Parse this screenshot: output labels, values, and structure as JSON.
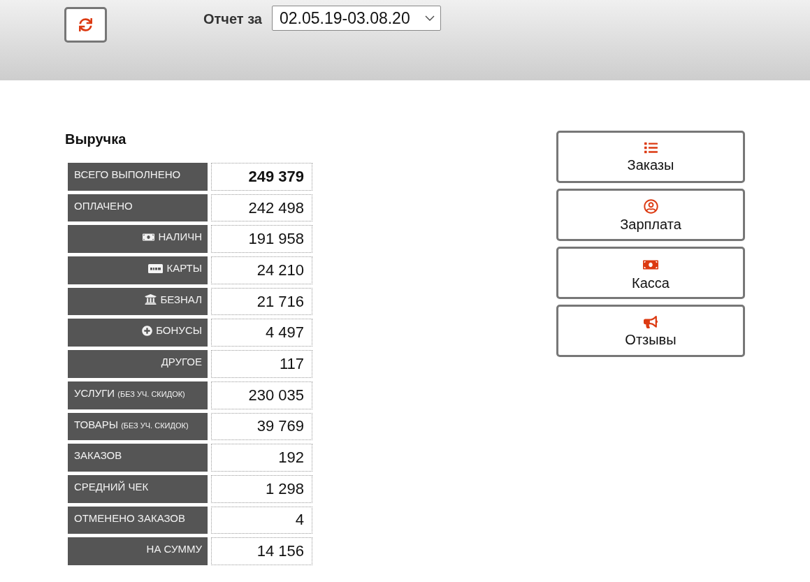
{
  "toolbar": {
    "report_label": "Отчет за",
    "period": {
      "value": "02.05.19-03.08.20"
    }
  },
  "revenue": {
    "title": "Выручка",
    "rows": [
      {
        "label": "ВСЕГО ВЫПОЛНЕНО",
        "value": "249 379",
        "kind": "main",
        "emphasized": true
      },
      {
        "label": "ОПЛАЧЕНО",
        "value": "242 498",
        "kind": "main",
        "emphasized": false
      },
      {
        "label": "НАЛИЧН",
        "value": "191 958",
        "kind": "cash",
        "emphasized": false
      },
      {
        "label": "КАРТЫ",
        "value": "24 210",
        "kind": "card",
        "emphasized": false
      },
      {
        "label": "БЕЗНАЛ",
        "value": "21 716",
        "kind": "bank",
        "emphasized": false
      },
      {
        "label": "БОНУСЫ",
        "value": "4 497",
        "kind": "bonus",
        "emphasized": false
      },
      {
        "label": "ДРУГОЕ",
        "value": "117",
        "kind": "sub",
        "emphasized": false
      },
      {
        "label": "УСЛУГИ",
        "note": "(БЕЗ УЧ. СКИДОК)",
        "value": "230 035",
        "kind": "main",
        "emphasized": false
      },
      {
        "label": "ТОВАРЫ",
        "note": "(БЕЗ УЧ. СКИДОК)",
        "value": "39 769",
        "kind": "main",
        "emphasized": false
      },
      {
        "label": "ЗАКАЗОВ",
        "value": "192",
        "kind": "main",
        "emphasized": false
      },
      {
        "label": "СРЕДНИЙ ЧЕК",
        "value": "1 298",
        "kind": "main",
        "emphasized": false
      },
      {
        "label": "ОТМЕНЕНО ЗАКАЗОВ",
        "value": "4",
        "kind": "main",
        "emphasized": false
      },
      {
        "label": "НА СУММУ",
        "value": "14 156",
        "kind": "sub",
        "emphasized": false
      }
    ]
  },
  "nav_buttons": [
    {
      "label": "Заказы",
      "kind": "list"
    },
    {
      "label": "Зарплата",
      "kind": "user"
    },
    {
      "label": "Касса",
      "kind": "money"
    },
    {
      "label": "Отзывы",
      "kind": "megaphone"
    }
  ]
}
